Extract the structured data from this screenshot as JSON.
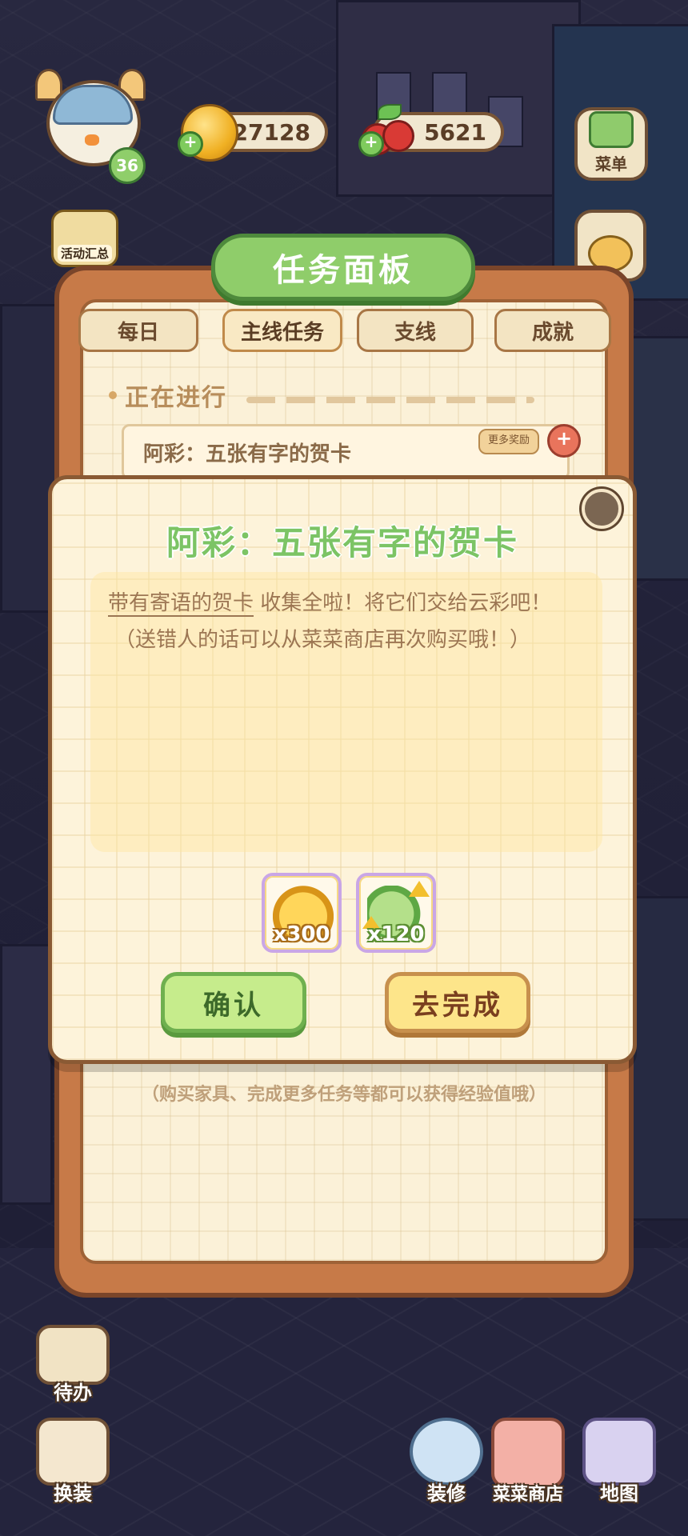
{
  "hud": {
    "level": "36",
    "gold": "27128",
    "cherry": "5621",
    "menu_label": "菜单",
    "activity_label": "活动汇总"
  },
  "board": {
    "title": "任务面板",
    "tabs": [
      "每日",
      "主线任务",
      "支线",
      "成就"
    ],
    "active_tab": "主线任务",
    "section": "正在进行",
    "current_task": "阿彩：五张有字的贺卡",
    "more_rewards_tag": "更多奖励",
    "exp_note": "（购买家具、完成更多任务等都可以获得经验值哦）"
  },
  "modal": {
    "title": "阿彩：五张有字的贺卡",
    "desc_line1_underlined": "带有寄语的贺卡",
    "desc_line1_rest": " 收集全啦！将它们交给云彩吧！",
    "desc_line2": "（送错人的话可以从菜菜商店再次购买哦！）",
    "rewards": [
      {
        "icon": "gold-coin-pile-icon",
        "qty": "x300"
      },
      {
        "icon": "green-exp-icon",
        "qty": "x120"
      }
    ],
    "confirm_label": "确认",
    "complete_label": "去完成"
  },
  "nav": {
    "todo": "待办",
    "dress": "换装",
    "decorate": "装修",
    "shop": "菜菜商店",
    "map": "地图"
  }
}
